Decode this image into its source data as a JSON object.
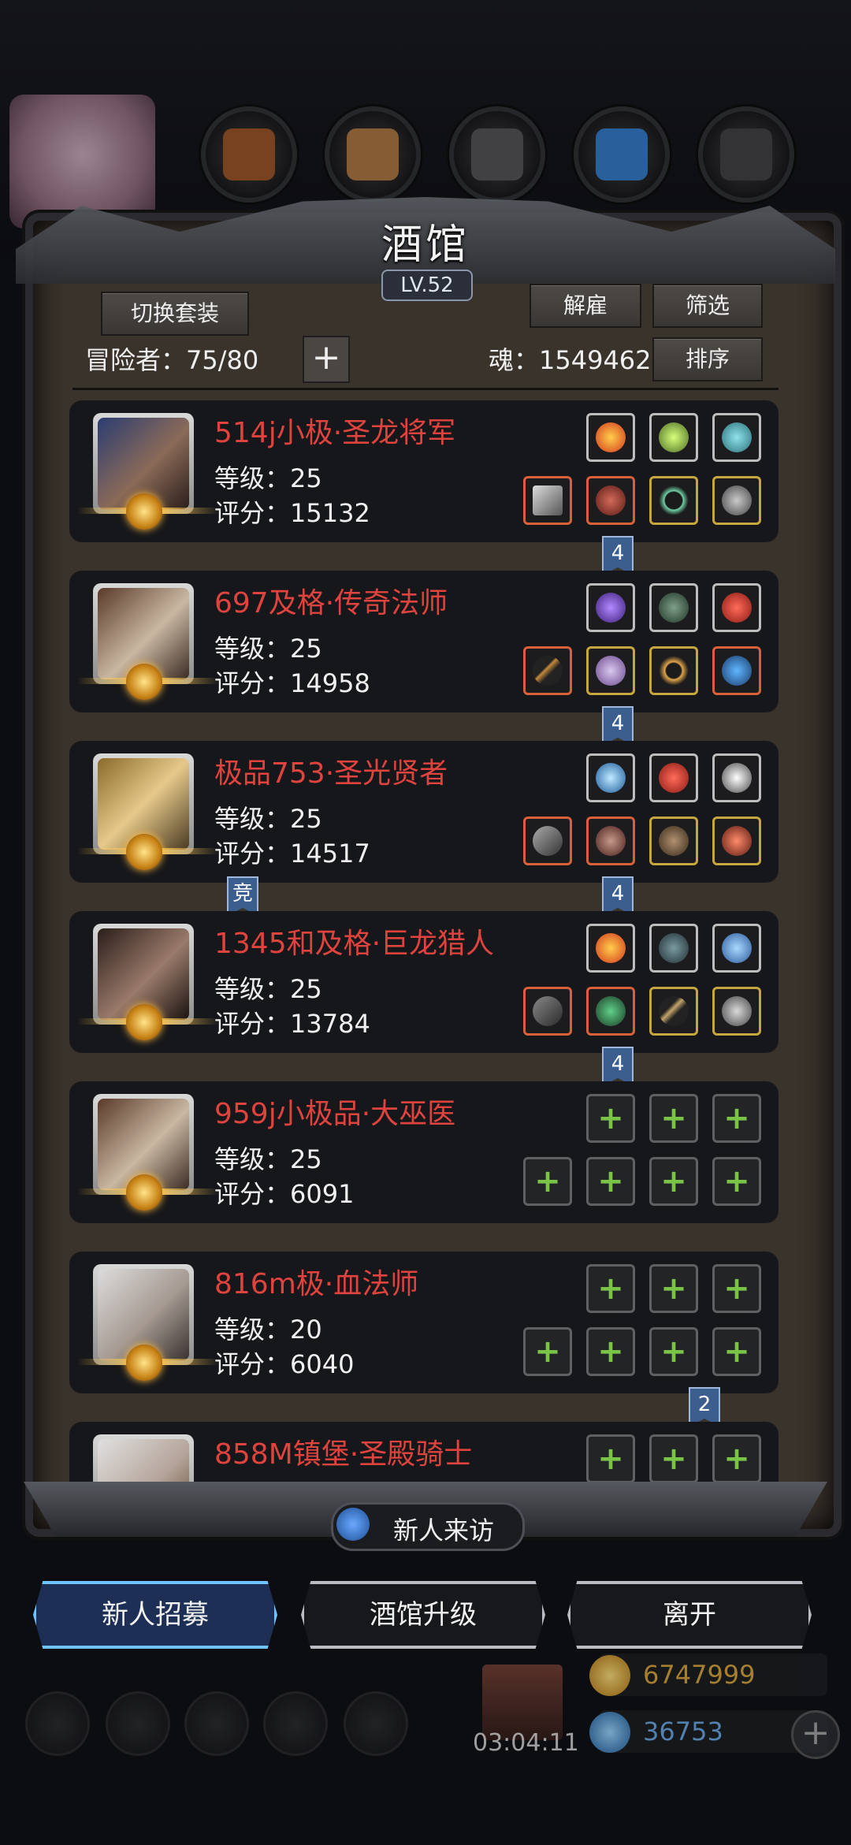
{
  "header": {
    "title": "酒馆",
    "level": "LV.52",
    "switch_suit_label": "切换套装",
    "dismiss_label": "解雇",
    "filter_label": "筛选",
    "sort_label": "排序",
    "adventurers_label": "冒险者：75/80",
    "soul_label": "魂：1549462",
    "add_label": "+"
  },
  "heroes": [
    {
      "name": "514j小极·圣龙将军",
      "level": "等级：25",
      "score": "评分：15132",
      "ribbon": "4"
    },
    {
      "name": "697及格·传奇法师",
      "level": "等级：25",
      "score": "评分：14958",
      "ribbon": "4"
    },
    {
      "name": "极品753·圣光贤者",
      "level": "等级：25",
      "score": "评分：14517",
      "ribbon": "4",
      "tag": "竞"
    },
    {
      "name": "1345和及格·巨龙猎人",
      "level": "等级：25",
      "score": "评分：13784",
      "ribbon": "4"
    },
    {
      "name": "959j小极品·大巫医",
      "level": "等级：25",
      "score": "评分：6091",
      "ribbon": ""
    },
    {
      "name": "816m极·血法师",
      "level": "等级：20",
      "score": "评分：6040",
      "ribbon": "2"
    },
    {
      "name": "858M镇堡·圣殿骑士",
      "level": "",
      "score": "",
      "ribbon": ""
    }
  ],
  "visit_label": "新人来访",
  "actions": {
    "recruit": "新人招募",
    "upgrade": "酒馆升级",
    "leave": "离开"
  },
  "resources": {
    "gold": "6747999",
    "gems": "36753",
    "timer": "03:04:11"
  },
  "colors": {
    "name_red": "#e0433d",
    "slot_gold": "#c8a63f",
    "slot_red": "#d8603a",
    "empty_plus": "#79c34a",
    "active_button": "#6fc4ff"
  }
}
